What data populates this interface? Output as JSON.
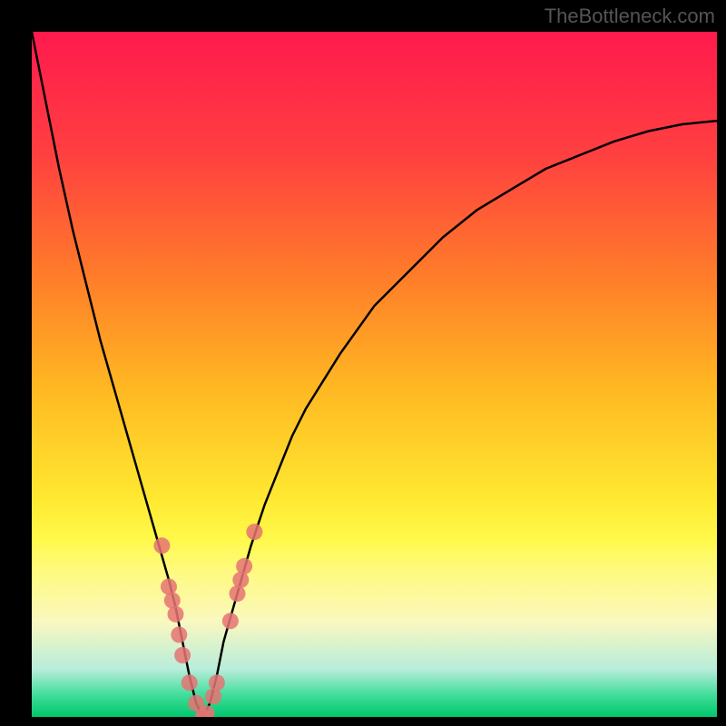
{
  "watermark": "TheBottleneck.com",
  "chart_data": {
    "type": "line",
    "title": "",
    "xlabel": "",
    "ylabel": "",
    "xlim": [
      0,
      100
    ],
    "ylim": [
      0,
      100
    ],
    "series": [
      {
        "name": "curve",
        "x": [
          0,
          2,
          4,
          6,
          8,
          10,
          12,
          14,
          16,
          18,
          20,
          21,
          22,
          23,
          24,
          25,
          26,
          27,
          28,
          30,
          32,
          34,
          36,
          38,
          40,
          45,
          50,
          55,
          60,
          65,
          70,
          75,
          80,
          85,
          90,
          95,
          100
        ],
        "y": [
          100,
          90,
          80,
          71,
          63,
          55,
          48,
          41,
          34,
          27,
          20,
          16,
          11,
          6,
          2,
          0,
          2,
          6,
          11,
          18,
          25,
          31,
          36,
          41,
          45,
          53,
          60,
          65,
          70,
          74,
          77,
          80,
          82,
          84,
          85.5,
          86.5,
          87
        ]
      }
    ],
    "markers": [
      {
        "x": 19,
        "y": 25
      },
      {
        "x": 20,
        "y": 19
      },
      {
        "x": 20.5,
        "y": 17
      },
      {
        "x": 21,
        "y": 15
      },
      {
        "x": 21.5,
        "y": 12
      },
      {
        "x": 22,
        "y": 9
      },
      {
        "x": 23,
        "y": 5
      },
      {
        "x": 24,
        "y": 2
      },
      {
        "x": 25,
        "y": 0
      },
      {
        "x": 25.5,
        "y": 0.5
      },
      {
        "x": 26.5,
        "y": 3
      },
      {
        "x": 27,
        "y": 5
      },
      {
        "x": 29,
        "y": 14
      },
      {
        "x": 30,
        "y": 18
      },
      {
        "x": 30.5,
        "y": 20
      },
      {
        "x": 31,
        "y": 22
      },
      {
        "x": 32.5,
        "y": 27
      }
    ],
    "gradient_stops": [
      {
        "offset": 0,
        "color": "#ff1a4d"
      },
      {
        "offset": 18,
        "color": "#ff4040"
      },
      {
        "offset": 35,
        "color": "#ff7a2a"
      },
      {
        "offset": 52,
        "color": "#ffb822"
      },
      {
        "offset": 68,
        "color": "#ffe831"
      },
      {
        "offset": 74,
        "color": "#fff94a"
      },
      {
        "offset": 78,
        "color": "#fffa78"
      },
      {
        "offset": 86,
        "color": "#faf8be"
      },
      {
        "offset": 93,
        "color": "#b8eddb"
      },
      {
        "offset": 97,
        "color": "#3cdc97"
      },
      {
        "offset": 100,
        "color": "#00c76b"
      }
    ]
  }
}
